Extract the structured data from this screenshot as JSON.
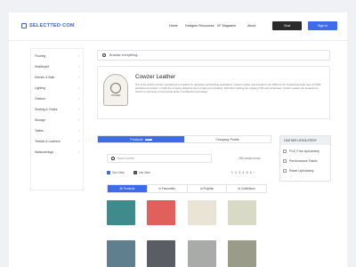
{
  "header": {
    "logo": "SELECTTED·COM",
    "nav": [
      "Home",
      "Designer Resources",
      "XF Magazine",
      "About"
    ],
    "chat_label": "Chat",
    "signin_label": "Sign In"
  },
  "sidebar": {
    "items": [
      "Flooring",
      "Healthcare",
      "Kitchen & Bath",
      "Lighting",
      "Outdoor",
      "Seating & Chairs",
      "Storage",
      "Tables",
      "Textiles & Leathers",
      "Wallcoverings"
    ]
  },
  "search": {
    "placeholder": "Browse everything..."
  },
  "profile": {
    "company_name": "Cowzer Leather",
    "logo_text": "COWZER",
    "description": "One of the world's premier manufacturers of leather for upholstery and finishing applications. Cowzer Leather was founded in the 1960s by the husband-and-wife team of Pablo and Rebecca Cowzer. In 1991 the company shifted its focus to high-end upholstery. With 2011 marking the company's 50-year anniversary, Cowzer Leather can presently be found in a vast array of commercial works of architecture and design."
  },
  "tabs": {
    "products_label": "Products",
    "products_badge": "NEW",
    "profile_label": "Company Profile"
  },
  "products": {
    "search_placeholder": "Search series",
    "results": "255 results found",
    "grid_view": "Grid View",
    "list_view": "List View",
    "pages": [
      "1",
      "2",
      "3",
      "4",
      "5",
      "6",
      "›"
    ],
    "filters": [
      "All Products",
      "In Favourites",
      "In Projects",
      "In Collections"
    ],
    "swatch_colors": [
      "#3f8a8a",
      "#e0615b",
      "#e9e4d6",
      "#d9dac5",
      "#5f7f8f",
      "#5a5d63",
      "#a9aba8",
      "#9b9b8a"
    ]
  },
  "leather_filter": {
    "title": "LEATHER UPHOLSTERY",
    "options": [
      "PVC Free Upholstery",
      "Performance Fabric",
      "Reset Upholstery"
    ]
  },
  "colors": {
    "accent": "#3d6bea",
    "dark": "#2b2b2b"
  }
}
